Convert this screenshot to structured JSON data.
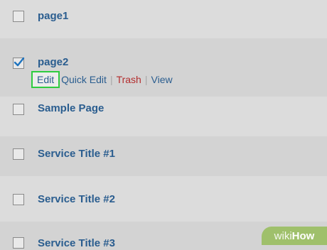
{
  "rows": [
    {
      "title": "page1",
      "checked": false
    },
    {
      "title": "page2",
      "checked": true
    },
    {
      "title": "Sample Page",
      "checked": false
    },
    {
      "title": "Service Title #1",
      "checked": false
    },
    {
      "title": "Service Title #2",
      "checked": false
    },
    {
      "title": "Service Title #3",
      "checked": false
    }
  ],
  "row_actions": {
    "edit": "Edit",
    "quick_edit": "Quick Edit",
    "trash": "Trash",
    "view": "View",
    "separator": "|"
  },
  "watermark": {
    "wiki": "wiki",
    "how": "How"
  },
  "colors": {
    "link": "#2a5d8f",
    "trash": "#b32d2e",
    "highlight": "#2ecc40",
    "watermark_bg": "#9fc06b"
  }
}
